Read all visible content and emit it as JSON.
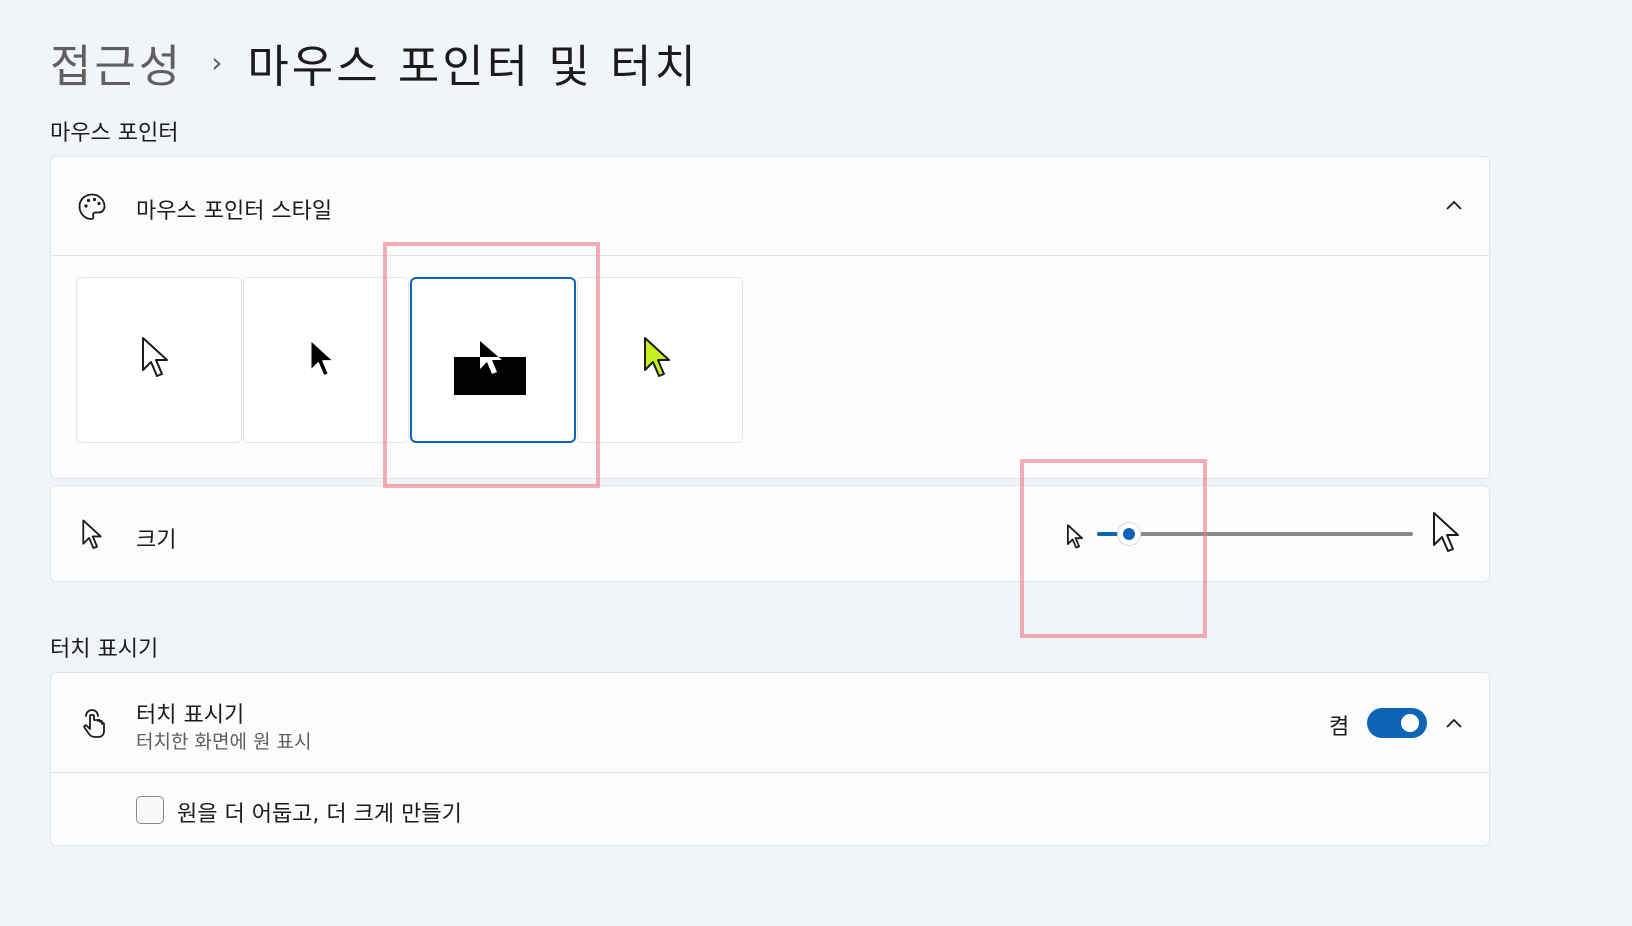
{
  "breadcrumb": {
    "parent": "접근성",
    "separator": "›",
    "current": "마우스 포인터 및 터치"
  },
  "sections": {
    "mouse_pointer": "마우스 포인터",
    "touch_indicator": "터치 표시기"
  },
  "pointer_style": {
    "label": "마우스 포인터 스타일",
    "icon": "palette-icon",
    "expand_icon": "chevron-up-icon",
    "options": [
      {
        "name": "white",
        "selected": false
      },
      {
        "name": "black",
        "selected": false
      },
      {
        "name": "inverted",
        "selected": true
      },
      {
        "name": "custom",
        "selected": false,
        "color": "#c6f01e"
      }
    ]
  },
  "size": {
    "label": "크기",
    "icon": "pointer-icon",
    "slider_value_fraction": 0.1
  },
  "touch": {
    "label": "터치 표시기",
    "description": "터치한 화면에 원 표시",
    "icon": "touch-icon",
    "state_label": "켬",
    "toggle_on": true,
    "checkbox_label": "원을 더 어둡고, 더 크게 만들기",
    "checkbox_checked": false
  },
  "colors": {
    "accent": "#0f64b8",
    "highlight": "#ee7882"
  }
}
